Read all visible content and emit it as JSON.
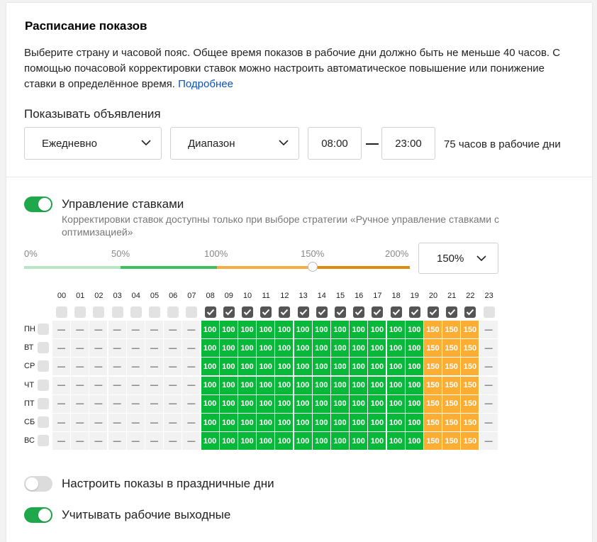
{
  "header": {
    "title": "Расписание показов",
    "description": "Выберите страну и часовой пояс. Общее время показов в рабочие дни должно быть не меньше 40 часов. С помощью почасовой корректировки ставок можно настроить автоматическое повышение или понижение ставки в определённое время.",
    "more_link": "Подробнее"
  },
  "show_ads": {
    "label": "Показывать объявления",
    "frequency": "Ежедневно",
    "mode": "Диапазон",
    "time_from": "08:00",
    "time_to": "23:00",
    "hours_note": "75 часов в рабочие дни"
  },
  "bid_management": {
    "enabled": true,
    "label": "Управление ставками",
    "hint": "Корректировки ставок доступны только при выборе стратегии «Ручное управление ставками с оптимизацией»",
    "scale": [
      "0%",
      "50%",
      "100%",
      "150%",
      "200%"
    ],
    "slider_value_percent": 150,
    "selected": "150%"
  },
  "schedule": {
    "hours": [
      "00",
      "01",
      "02",
      "03",
      "04",
      "05",
      "06",
      "07",
      "08",
      "09",
      "10",
      "11",
      "12",
      "13",
      "14",
      "15",
      "16",
      "17",
      "18",
      "19",
      "20",
      "21",
      "22",
      "23"
    ],
    "hour_checked": [
      false,
      false,
      false,
      false,
      false,
      false,
      false,
      false,
      true,
      true,
      true,
      true,
      true,
      true,
      true,
      true,
      true,
      true,
      true,
      true,
      true,
      true,
      true,
      false
    ],
    "days": [
      "ПН",
      "ВТ",
      "СР",
      "ЧТ",
      "ПТ",
      "СБ",
      "ВС"
    ],
    "row_values": [
      "—",
      "—",
      "—",
      "—",
      "—",
      "—",
      "—",
      "—",
      "100",
      "100",
      "100",
      "100",
      "100",
      "100",
      "100",
      "100",
      "100",
      "100",
      "100",
      "100",
      "150",
      "150",
      "150",
      "—"
    ]
  },
  "holidays": {
    "enabled": false,
    "label": "Настроить показы в праздничные дни"
  },
  "working_weekends": {
    "enabled": true,
    "label": "Учитывать рабочие выходные"
  },
  "colors": {
    "accent_green": "#1fa84b",
    "cell_100": "#08b838",
    "cell_150": "#fbae33",
    "link": "#0a52c2"
  }
}
